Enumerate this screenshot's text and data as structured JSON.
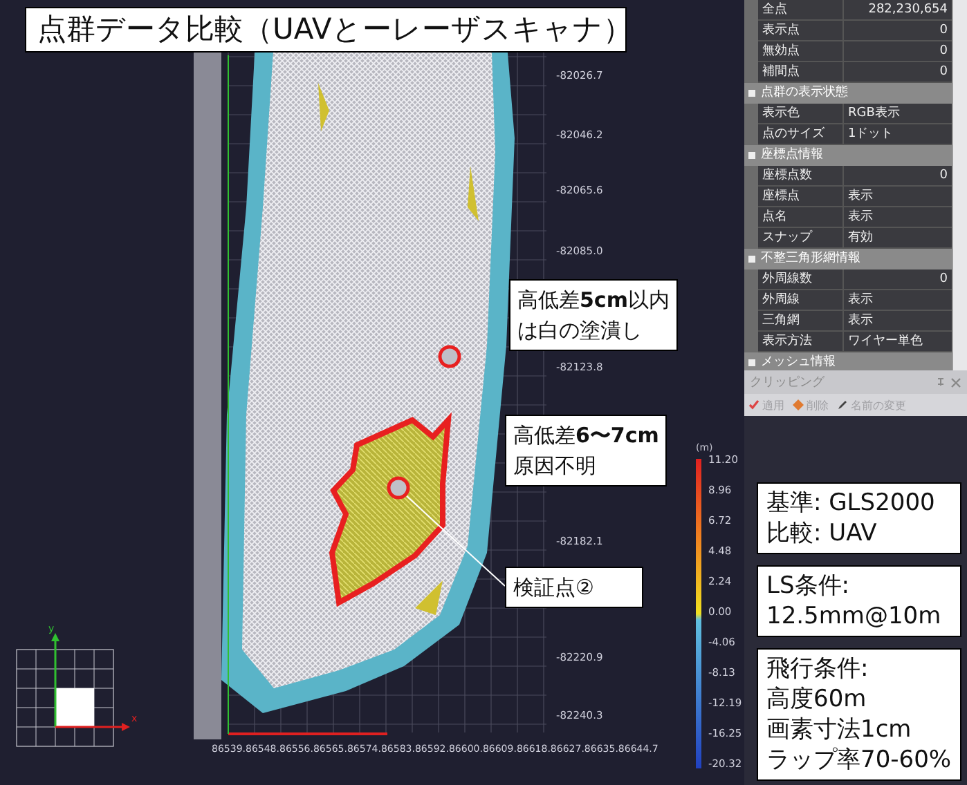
{
  "title": "点群データ比較（UAVとーレーザスキャナ）",
  "y_axis_labels": [
    "-82026.7",
    "-82046.2",
    "-82065.6",
    "-82085.0",
    "-82123.8",
    "-82182.1",
    "-82220.9",
    "-82240.3"
  ],
  "x_axis_label": "86539.86548.86556.86565.86574.86583.86592.86600.86609.86618.86627.86635.86644.7",
  "axis_gizmo": {
    "y_label": "y",
    "x_label": "x"
  },
  "color_scale": {
    "unit": "(m)",
    "ticks": [
      "11.20",
      "8.96",
      "6.72",
      "4.48",
      "2.24",
      "0.00",
      "-4.06",
      "-8.13",
      "-12.19",
      "-16.25",
      "-20.32"
    ]
  },
  "callouts": [
    {
      "lines": [
        "高低差**5cm**以内",
        "は白の塗潰し"
      ]
    },
    {
      "lines": [
        "高低差**6〜7cm**",
        "原因不明"
      ]
    },
    {
      "lines": [
        "検証点②"
      ]
    }
  ],
  "properties": [
    {
      "kind": "number",
      "label": "全点",
      "value": "282,230,654"
    },
    {
      "kind": "number",
      "label": "表示点",
      "value": "0"
    },
    {
      "kind": "number",
      "label": "無効点",
      "value": "0"
    },
    {
      "kind": "number",
      "label": "補間点",
      "value": "0"
    },
    {
      "kind": "section",
      "label": "点群の表示状態"
    },
    {
      "kind": "text",
      "label": "表示色",
      "value": "RGB表示"
    },
    {
      "kind": "text",
      "label": "点のサイズ",
      "value": "1ドット"
    },
    {
      "kind": "section",
      "label": "座標点情報"
    },
    {
      "kind": "number",
      "label": "座標点数",
      "value": "0"
    },
    {
      "kind": "text",
      "label": "座標点",
      "value": "表示"
    },
    {
      "kind": "text",
      "label": "点名",
      "value": "表示"
    },
    {
      "kind": "text",
      "label": "スナップ",
      "value": "有効"
    },
    {
      "kind": "section",
      "label": "不整三角形網情報"
    },
    {
      "kind": "number",
      "label": "外周線数",
      "value": "0"
    },
    {
      "kind": "text",
      "label": "外周線",
      "value": "表示"
    },
    {
      "kind": "text",
      "label": "三角網",
      "value": "表示"
    },
    {
      "kind": "text",
      "label": "表示方法",
      "value": "ワイヤー単色"
    },
    {
      "kind": "section",
      "label": "メッシュ情報"
    }
  ],
  "clipping_panel": {
    "title": "クリッピング",
    "toolbar": [
      {
        "kind": "apply",
        "label": "適用",
        "disabled": true
      },
      {
        "kind": "delete",
        "label": "削除",
        "disabled": true
      },
      {
        "kind": "rename",
        "label": "名前の変更",
        "disabled": true
      }
    ]
  },
  "notes": [
    {
      "lines": [
        "基準: GLS2000",
        "比較: UAV"
      ]
    },
    {
      "lines": [
        "LS条件:",
        "12.5mm@10m"
      ]
    },
    {
      "lines": [
        "飛行条件:",
        "高度60m",
        "画素寸法1cm",
        "ラップ率70-60%"
      ]
    }
  ]
}
